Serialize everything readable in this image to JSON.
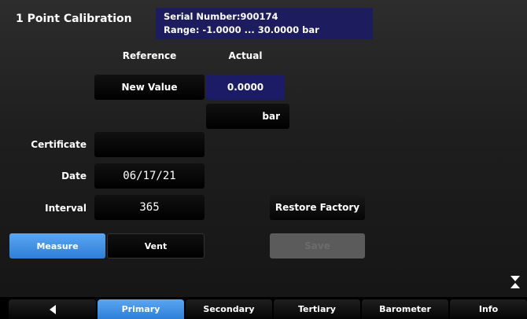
{
  "title": "1 Point Calibration",
  "device": {
    "serial_line": "Serial Number:900174",
    "range_line": "Range: -1.0000 ... 30.0000 bar"
  },
  "columns": {
    "reference": "Reference",
    "actual": "Actual"
  },
  "reference": {
    "new_value_label": "New Value"
  },
  "actual": {
    "value": "0.0000",
    "unit": "bar"
  },
  "fields": {
    "certificate_label": "Certificate",
    "certificate_value": "",
    "date_label": "Date",
    "date_value": "06/17/21",
    "interval_label": "Interval",
    "interval_value": "365"
  },
  "buttons": {
    "restore_factory": "Restore Factory",
    "measure": "Measure",
    "vent": "Vent",
    "save": "Save"
  },
  "tabs": [
    {
      "label": "",
      "icon": "back-arrow-icon"
    },
    {
      "label": "Primary",
      "active": true
    },
    {
      "label": "Secondary"
    },
    {
      "label": "Tertiary"
    },
    {
      "label": "Barometer"
    },
    {
      "label": "Info"
    }
  ],
  "colors": {
    "accent_blue": "#2d7fd8",
    "header_navy": "#1c1c5e",
    "value_navy": "#1b1b66"
  }
}
